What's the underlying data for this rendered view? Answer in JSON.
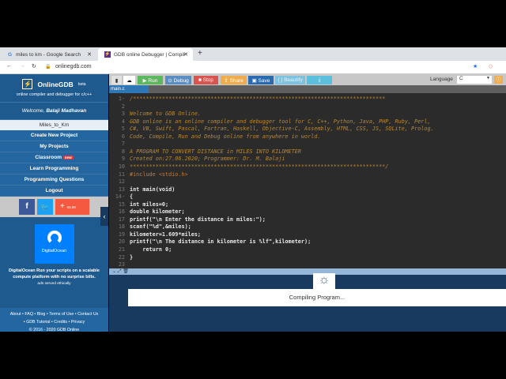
{
  "browser": {
    "tabs": [
      {
        "label": "miles to km - Google Search"
      },
      {
        "label": "GDB online Debugger | Compiler"
      }
    ],
    "url": "onlinegdb.com"
  },
  "sidebar": {
    "brand": "OnlineGDB",
    "beta": "beta",
    "tagline": "online compiler and debugger for c/c++",
    "welcome": "Welcome,",
    "user": "Balaji Madhavan",
    "project": "Miles_to_Km",
    "nav": [
      {
        "label": "Create New Project"
      },
      {
        "label": "My Projects"
      },
      {
        "label": "Classroom",
        "badge": "new"
      },
      {
        "label": "Learn Programming"
      },
      {
        "label": "Programming Questions"
      },
      {
        "label": "Logout"
      }
    ],
    "share_count": "65.8K",
    "ad_brand": "DigitalOcean",
    "ad_text": "DigitalOcean Run your scripts on a scalable compute platform with no surprise bills.",
    "ad_note": "ads served ethically",
    "footer_links": [
      "About",
      "FAQ",
      "Blog",
      "Terms of Use",
      "Contact Us",
      "GDB Tutorial",
      "Credits",
      "Privacy"
    ],
    "copyright": "© 2016 - 2020 GDB Online"
  },
  "toolbar": {
    "run": "▶ Run",
    "debug": "⊙ Debug",
    "stop": "■ Stop",
    "share": "⇪ Share",
    "save": "▣ Save",
    "beautify": "{ } Beautify",
    "download": "⤓",
    "language_label": "Language",
    "language": "C"
  },
  "file_tab": "main.c",
  "code": [
    "/******************************************************************************",
    "",
    "Welcome to GDB Online.",
    "GDB online is an online compiler and debugger tool for C, C++, Python, Java, PHP, Ruby, Perl,",
    "C#, VB, Swift, Pascal, Fortran, Haskell, Objective-C, Assembly, HTML, CSS, JS, SQLite, Prolog.",
    "Code, Compile, Run and Debug online from anywhere in world.",
    "",
    "A PROGRAM TO CONVERT DISTANCE in MILES INTO KILOMETER",
    "Created on:27.06.2020; Programmer: Dr. M. Balaji",
    "*******************************************************************************/",
    "#include <stdio.h>",
    "",
    "int main(void)",
    "{",
    "int miles=0;",
    "double kilometer;",
    "printf(\"\\n Enter the distance in miles:\");",
    "scanf(\"%d\",&miles);",
    "kilometer=1.609*miles;",
    "printf(\"\\n The distance in kilometer is %lf\",kilometer);",
    "    return 0;",
    "}",
    ""
  ],
  "status": "Compiling Program..."
}
